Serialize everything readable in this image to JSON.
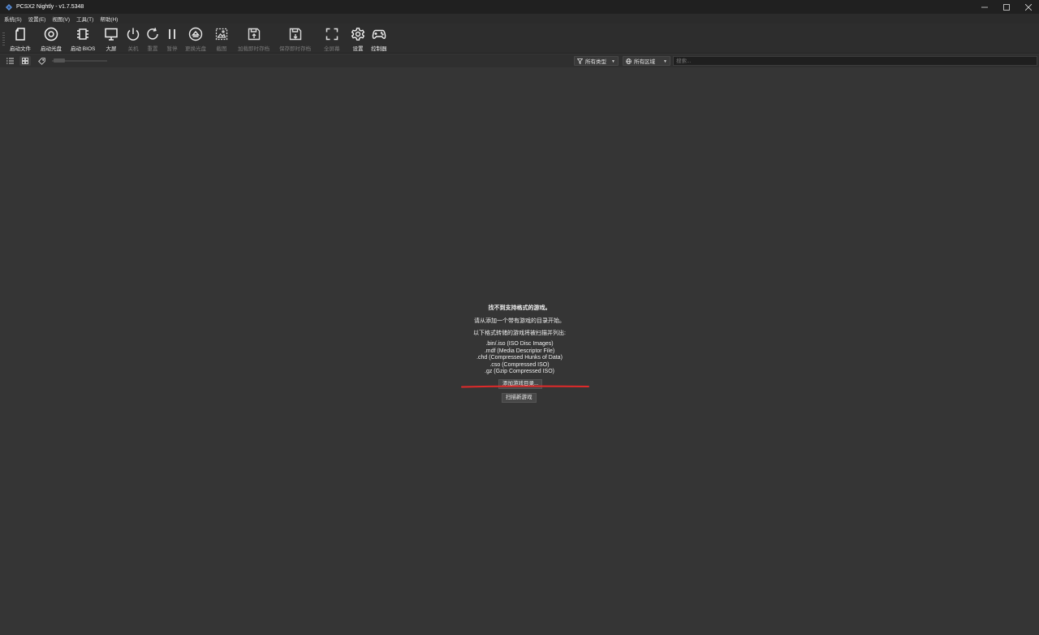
{
  "window": {
    "title": "PCSX2 Nightly - v1.7.5348"
  },
  "menu": {
    "items": [
      "系统(S)",
      "设置(E)",
      "视图(V)",
      "工具(T)",
      "帮助(H)"
    ]
  },
  "toolbar": {
    "start_file": "启动文件",
    "start_disc": "启动光盘",
    "start_bios": "启动 BIOS",
    "big_picture": "大屏",
    "shutdown": "关机",
    "reset": "重置",
    "pause": "暂停",
    "change_disc": "更换光盘",
    "screenshot": "截图",
    "load_state": "加载即时存档",
    "save_state": "保存即时存档",
    "fullscreen": "全屏幕",
    "settings": "设置",
    "controllers": "控制器"
  },
  "filters": {
    "type_filter": "所有类型",
    "region_filter": "所有区域",
    "search_placeholder": "搜索..."
  },
  "empty_state": {
    "heading": "找不到支持格式的游戏。",
    "hint": "请从添加一个带有游戏的目录开始。",
    "formats_intro": "以下格式转储的游戏将被扫描并列出:",
    "formats": [
      ".bin/.iso (ISO Disc Images)",
      ".mdf (Media Descriptor File)",
      ".chd (Compressed Hunks of Data)",
      ".cso (Compressed ISO)",
      ".gz (Gzip Compressed ISO)"
    ],
    "add_dir_button": "添加游戏目录...",
    "scan_button": "扫描新游戏"
  },
  "colors": {
    "background": "#353535",
    "annotation_underline": "#e02a2a"
  }
}
